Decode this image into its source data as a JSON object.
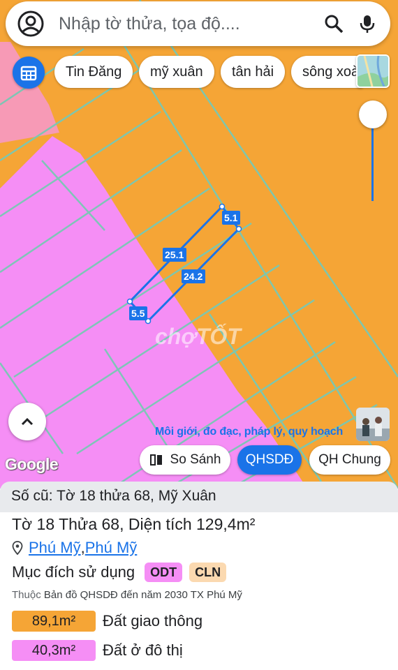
{
  "search": {
    "placeholder": "Nhập tờ thửa, tọa độ...."
  },
  "chips": [
    "Tin Đăng",
    "mỹ xuân",
    "tân hải",
    "sông xoài"
  ],
  "map": {
    "labels": {
      "top_edge": "5.1",
      "left_long": "25.1",
      "right_long": "24.2",
      "bottom_edge": "5.5"
    },
    "watermark": "chợTỐT",
    "ad_text": "Môi giới, đo đạc, pháp lý, quy hoạch",
    "google": "Google",
    "colors": {
      "orange": "#f5a536",
      "pink": "#f58ef5",
      "grid": "#78c8b4",
      "parcel": "#1a73e8"
    }
  },
  "map_buttons": {
    "compare": "So Sánh",
    "qhsdd": "QHSDĐ",
    "qh_chung": "QH Chung"
  },
  "sheet": {
    "old_ref": "Số cũ: Tờ 18 thửa 68, Mỹ Xuân",
    "title": "Tờ 18 Thửa 68, Diện tích 129,4m²",
    "location": {
      "ward": "Phú Mỹ",
      "separator": ", ",
      "town": "Phú Mỹ"
    },
    "purpose_label": "Mục đích sử dụng",
    "tags": [
      {
        "code": "ODT",
        "color": "#f58ef5"
      },
      {
        "code": "CLN",
        "color": "#fbd9b0"
      }
    ],
    "source_prefix": "Thuộc",
    "source": "Bản đồ QHSDĐ đến năm 2030 TX Phú Mỹ",
    "areas": [
      {
        "value": "89,1m²",
        "label": "Đất giao thông",
        "color": "#f5a536"
      },
      {
        "value": "40,3m²",
        "label": "Đất ở đô thị",
        "color": "#f58ef5"
      }
    ]
  }
}
